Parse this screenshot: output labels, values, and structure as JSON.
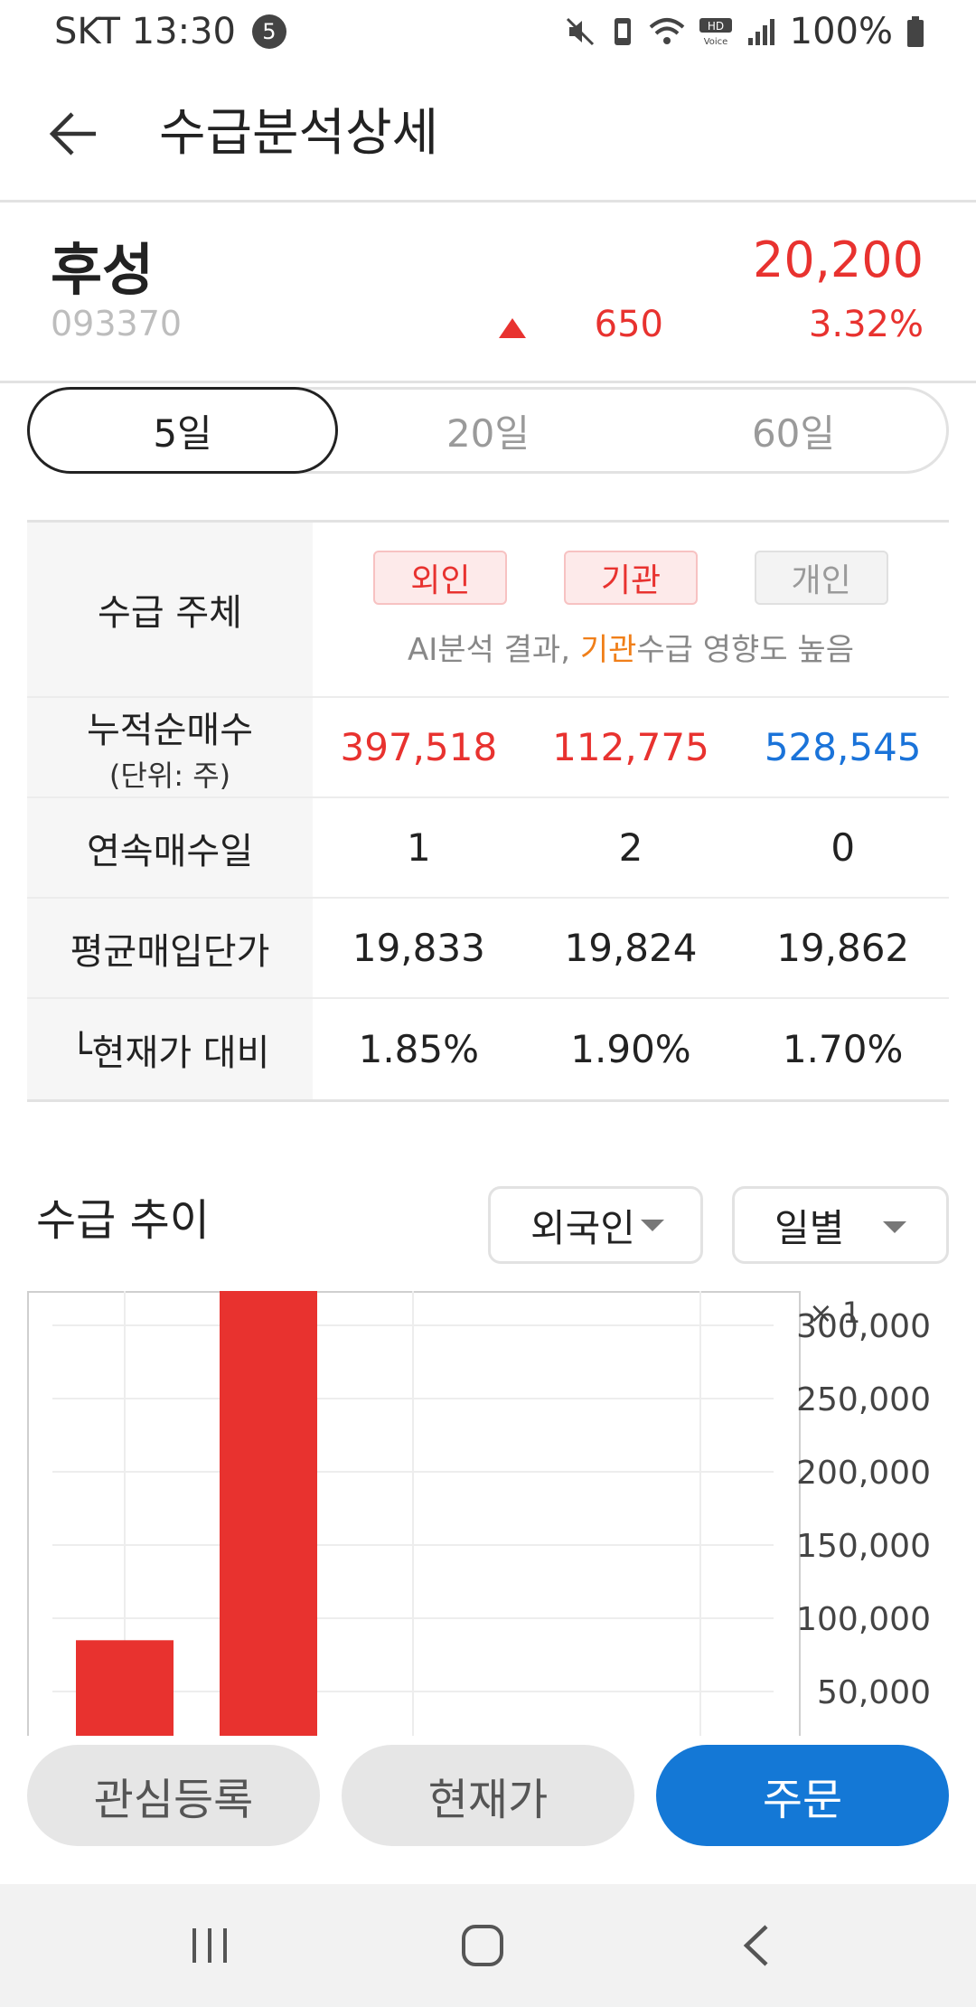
{
  "status_bar": {
    "carrier_time": "SKT 13:30",
    "notification_count": "5",
    "battery": "100%",
    "icons": [
      "mute-icon",
      "vibrate-icon",
      "wifi-icon",
      "hd-voice-icon",
      "signal-icon",
      "battery-icon"
    ]
  },
  "header": {
    "title": "수급분석상세",
    "back_icon": "arrow-left-icon"
  },
  "stock": {
    "name": "후성",
    "code": "093370",
    "price": "20,200",
    "change": "650",
    "change_rate": "3.32%",
    "up_color": "#e8322f"
  },
  "period_tabs": [
    {
      "label": "5일",
      "active": true
    },
    {
      "label": "20일",
      "active": false
    },
    {
      "label": "60일",
      "active": false
    }
  ],
  "table": {
    "subject_label": "수급 주체",
    "subjects": [
      "외인",
      "기관",
      "개인"
    ],
    "note_prefix": "AI분석 결과, ",
    "note_highlight": "기관",
    "note_suffix": "수급 영향도 높음",
    "rows": [
      {
        "label": "누적순매수",
        "sub": "(단위: 주)",
        "values": [
          "397,518",
          "112,775",
          "528,545"
        ]
      },
      {
        "label": "연속매수일",
        "values": [
          "1",
          "2",
          "0"
        ]
      },
      {
        "label": "평균매입단가",
        "values": [
          "19,833",
          "19,824",
          "19,862"
        ]
      },
      {
        "label": "└현재가 대비",
        "values": [
          "1.85%",
          "1.90%",
          "1.70%"
        ]
      }
    ]
  },
  "trend": {
    "title": "수급 추이",
    "investor_dropdown": "외국인",
    "period_dropdown": "일별"
  },
  "chart_data": {
    "type": "bar",
    "multiplier_label": "× 1",
    "y_ticks": [
      "300,000",
      "250,000",
      "200,000",
      "150,000",
      "100,000",
      "50,000"
    ],
    "values": [
      85000,
      325000,
      2500
    ],
    "bar_color": "#e8322f",
    "ylim": [
      0,
      330000
    ],
    "grid": true
  },
  "bottom_buttons": {
    "watch": "관심등록",
    "current_price": "현재가",
    "order": "주문"
  },
  "nav": {
    "recent_icon": "recent-apps-icon",
    "home_icon": "home-icon",
    "back_icon": "nav-back-icon"
  }
}
